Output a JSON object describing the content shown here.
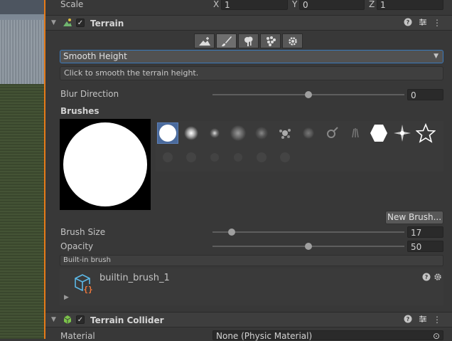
{
  "transform": {
    "scale_label": "Scale",
    "x_label": "X",
    "x_value": "1",
    "y_label": "Y",
    "y_value": "0",
    "z_label": "Z",
    "z_value": "1"
  },
  "terrain": {
    "title": "Terrain",
    "tools": [
      "terrain-create-icon",
      "paint-brush-icon",
      "place-trees-icon",
      "paint-details-icon",
      "settings-icon"
    ],
    "mode_dropdown": "Smooth Height",
    "help_text": "Click to smooth the terrain height.",
    "blur_direction_label": "Blur Direction",
    "blur_direction_value": "0",
    "blur_direction_fraction": 0.5,
    "brushes_label": "Brushes",
    "new_brush_label": "New Brush...",
    "brush_size_label": "Brush Size",
    "brush_size_value": "17",
    "brush_size_fraction": 0.1,
    "opacity_label": "Opacity",
    "opacity_value": "50",
    "opacity_fraction": 0.5,
    "builtin_label": "Built-in brush",
    "brush_asset_name": "builtin_brush_1"
  },
  "terrain_collider": {
    "title": "Terrain Collider",
    "material_label": "Material",
    "material_value": "None (Physic Material)"
  },
  "colors": {
    "accent": "#3a79bb",
    "divider": "#e67b18",
    "panel": "#383838"
  }
}
